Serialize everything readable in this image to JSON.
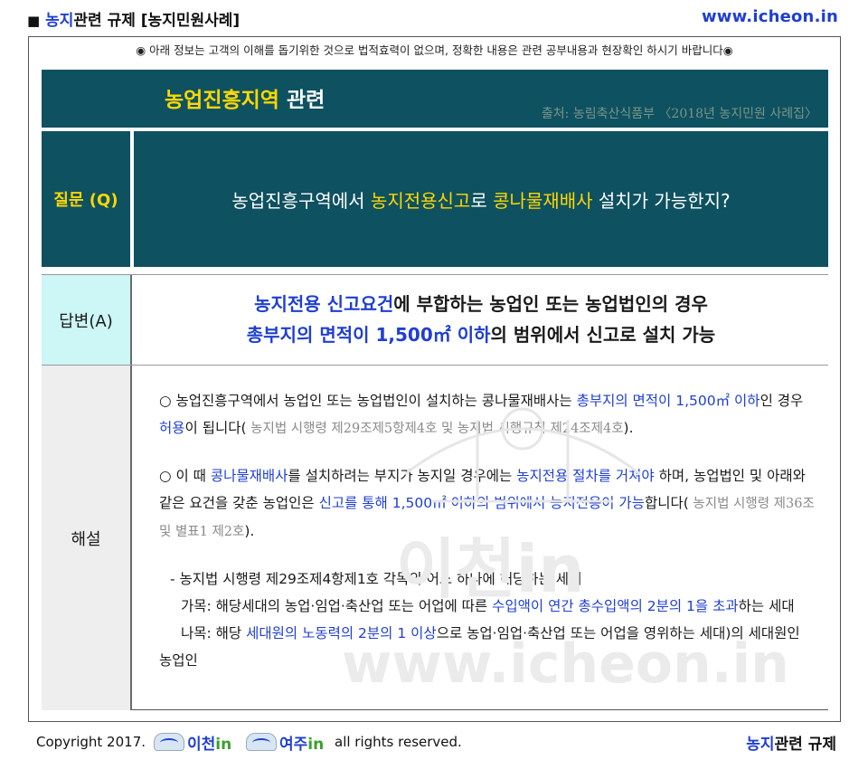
{
  "header": {
    "square": "■",
    "title_blue": "농지",
    "title_rest": "관련 규제 [농지민원사례]",
    "url": "www.icheon.in"
  },
  "disclaimer": "◉ 아래 정보는 고객의 이해를 돕기위한 것으로 법적효력이 없으며, 정확한 내용은 관련 공부내용과 현장확인 하시기 바랍니다◉",
  "title_bar": {
    "title_yellow": "농업진흥지역",
    "title_rest": " 관련",
    "source": "출처: 농림축산식품부 〈2018년 농지민원 사례집〉"
  },
  "question": {
    "label": "질문 (Q)",
    "t1": "농업진흥구역에서 ",
    "t2": "농지전용신고",
    "t3": "로 ",
    "t4": "콩나물재배사",
    "t5": " 설치가 가능한지?"
  },
  "answer": {
    "label": "답변(A)",
    "l1_blue": "농지전용 신고요건",
    "l1_rest": "에 부합하는 농업인 또는 농업법인의 경우",
    "l2_blue": "총부지의 면적이 1,500㎡ 이하",
    "l2_rest": "의 범위에서 신고로 설치 가능"
  },
  "explanation": {
    "label": "해설",
    "p1": {
      "a": "○ 농업진흥구역에서 농업인 또는 농업법인이 설치하는 콩나물재배사는 ",
      "b": "총부지의 면적이 1,500㎡ 이하",
      "c": "인 경우 ",
      "d": "허용",
      "e": "이 됩니다(",
      "f": " 농지법 시행령  제29조제5항제4호 및  농지법 시행규칙  제24조제4호",
      "g": ")."
    },
    "p2": {
      "a": "○ 이 때 ",
      "b": "콩나물재배사",
      "c": "를 설치하려는 부지가 농지일 경우에는 ",
      "d": "농지전용 절차를 거쳐야",
      "e": " 하며, 농업법인 및 아래와 같은 요건을 갖춘 농업인은 ",
      "f": "신고를 통해 1,500㎡ 이하의 범위에서 농지전용이 가능",
      "g": "합니다(",
      "h": " 농지법 시행령 제36조 및 별표1 제2호",
      "i": ")."
    },
    "sub0": "-  농지법 시행령  제29조제4항제1호 각목의 어느 하나에 해당하는 세대",
    "sub1": {
      "a": "가목: 해당세대의 농업·임업·축산업 또는 어업에 따른 ",
      "b": "수입액이 연간 총수입액의 2분의 1을 초과",
      "c": "하는 세대"
    },
    "sub2": {
      "a": "나목: 해당 ",
      "b": "세대원의 노동력의 2분의 1 이상",
      "c": "으로 농업·임업·축산업 또는 어업을 영위하는 세대)의 세대원인"
    },
    "sub3": "농업인"
  },
  "footer": {
    "copyright": "Copyright 2017.",
    "logo1_a": "이천",
    "logo1_b": "in",
    "logo2_a": "여주",
    "logo2_b": "in",
    "rights": "all rights reserved.",
    "right_blue": "농지",
    "right_rest": "관련 규제"
  },
  "colors": {
    "panel": "#0e5160",
    "accent_yellow": "#ffd700",
    "link_blue": "#1f3fd1",
    "answer_bg": "#cdf6f6",
    "explanation_bg": "#eeeeee"
  }
}
